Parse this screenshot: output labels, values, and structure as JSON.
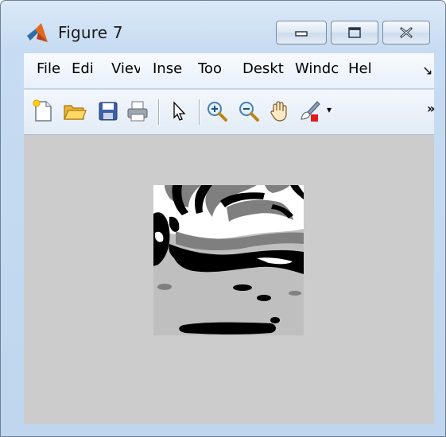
{
  "window": {
    "title": "Figure 7",
    "icon": "matlab-logo-icon"
  },
  "window_controls": {
    "minimize": "minimize-icon",
    "maximize": "maximize-icon",
    "close": "close-icon"
  },
  "menubar": {
    "items": [
      "File",
      "Edi",
      "Viev",
      "Inse",
      "Too",
      "Deskt",
      "Windc",
      "Hel"
    ],
    "overflow_icon": "chevron-down-right-icon"
  },
  "toolbar": {
    "items": [
      {
        "name": "new-figure-icon"
      },
      {
        "name": "open-file-icon"
      },
      {
        "name": "save-icon"
      },
      {
        "name": "print-icon"
      },
      {
        "name": "pointer-icon"
      },
      {
        "name": "zoom-in-icon"
      },
      {
        "name": "zoom-out-icon"
      },
      {
        "name": "pan-hand-icon"
      },
      {
        "name": "data-brushing-icon"
      }
    ],
    "overflow": "»",
    "dropdown": "▾"
  },
  "colors": {
    "canvas": "#cccccc",
    "image_black": "#000000",
    "image_white": "#ffffff",
    "image_dark_gray": "#7f7f7f",
    "image_light_gray": "#bfbfbf"
  }
}
